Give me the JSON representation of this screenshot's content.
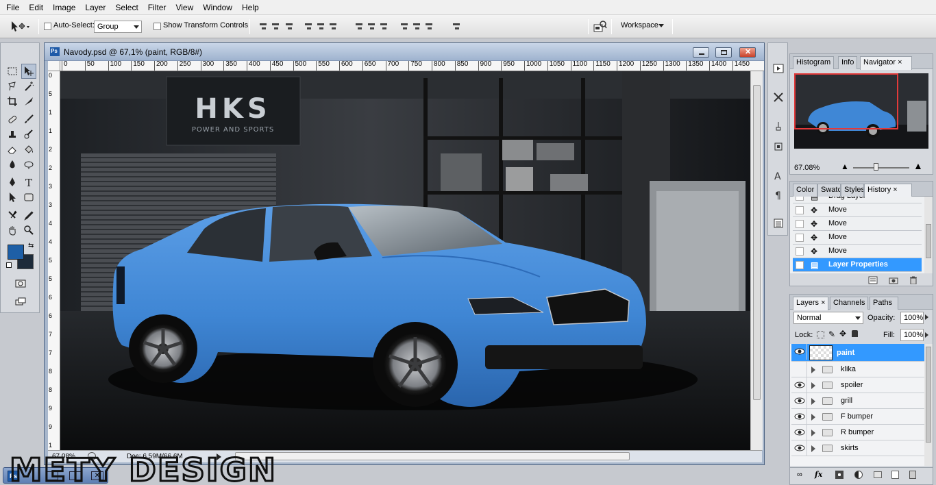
{
  "menu": [
    "File",
    "Edit",
    "Image",
    "Layer",
    "Select",
    "Filter",
    "View",
    "Window",
    "Help"
  ],
  "options_bar": {
    "auto_select_label": "Auto-Select:",
    "auto_select_value": "Group",
    "show_transform_label": "Show Transform Controls",
    "workspace_label": "Workspace"
  },
  "app_logo": "Ps",
  "document": {
    "title": "Navody.psd @ 67,1% (paint, RGB/8#)",
    "ruler_h": [
      "0",
      "50",
      "100",
      "150",
      "200",
      "250",
      "300",
      "350",
      "400",
      "450",
      "500",
      "550",
      "600",
      "650",
      "700",
      "750",
      "800",
      "850",
      "900",
      "950",
      "1000",
      "1050",
      "1100",
      "1150",
      "1200",
      "1250",
      "1300",
      "1350",
      "1400",
      "1450"
    ],
    "ruler_v": [
      "0",
      "5",
      "1",
      "1",
      "2",
      "2",
      "3",
      "3",
      "4",
      "4",
      "5",
      "5",
      "6",
      "6",
      "7",
      "7",
      "8",
      "8",
      "9",
      "9",
      "1"
    ],
    "zoom": "67.08%",
    "doc_info": "Doc: 6.59M/66.6M",
    "canvas_text": {
      "hks_title": "HKS",
      "hks_sub": "POWER AND SPORTS"
    }
  },
  "navigator": {
    "tabs": [
      "Histogram",
      "Info",
      "Navigator"
    ],
    "active_tab": "Navigator",
    "zoom": "67.08%"
  },
  "history": {
    "tabs": [
      "Color",
      "Swatc",
      "Styles",
      "History"
    ],
    "active_tab": "History",
    "items": [
      "Drag Layer",
      "Move",
      "Move",
      "Move",
      "Move",
      "Layer Properties"
    ],
    "selected_index": 5
  },
  "layers": {
    "tabs": [
      "Layers",
      "Channels",
      "Paths"
    ],
    "active_tab": "Layers",
    "blend_mode": "Normal",
    "opacity_label": "Opacity:",
    "opacity": "100%",
    "lock_label": "Lock:",
    "fill_label": "Fill:",
    "fill": "100%",
    "items": [
      {
        "name": "paint",
        "visible": true,
        "type": "layer",
        "selected": true
      },
      {
        "name": "klika",
        "visible": false,
        "type": "group"
      },
      {
        "name": "spoiler",
        "visible": true,
        "type": "group"
      },
      {
        "name": "grill",
        "visible": true,
        "type": "group"
      },
      {
        "name": "F bumper",
        "visible": true,
        "type": "group"
      },
      {
        "name": "R bumper",
        "visible": true,
        "type": "group"
      },
      {
        "name": "skirts",
        "visible": true,
        "type": "group"
      }
    ]
  },
  "watermark": "METY DESIGN",
  "colors": {
    "foreground": "#1e5fa6",
    "background": "#1d2b3a",
    "selection": "#3399ff",
    "car_blue": "#3f87d6"
  }
}
